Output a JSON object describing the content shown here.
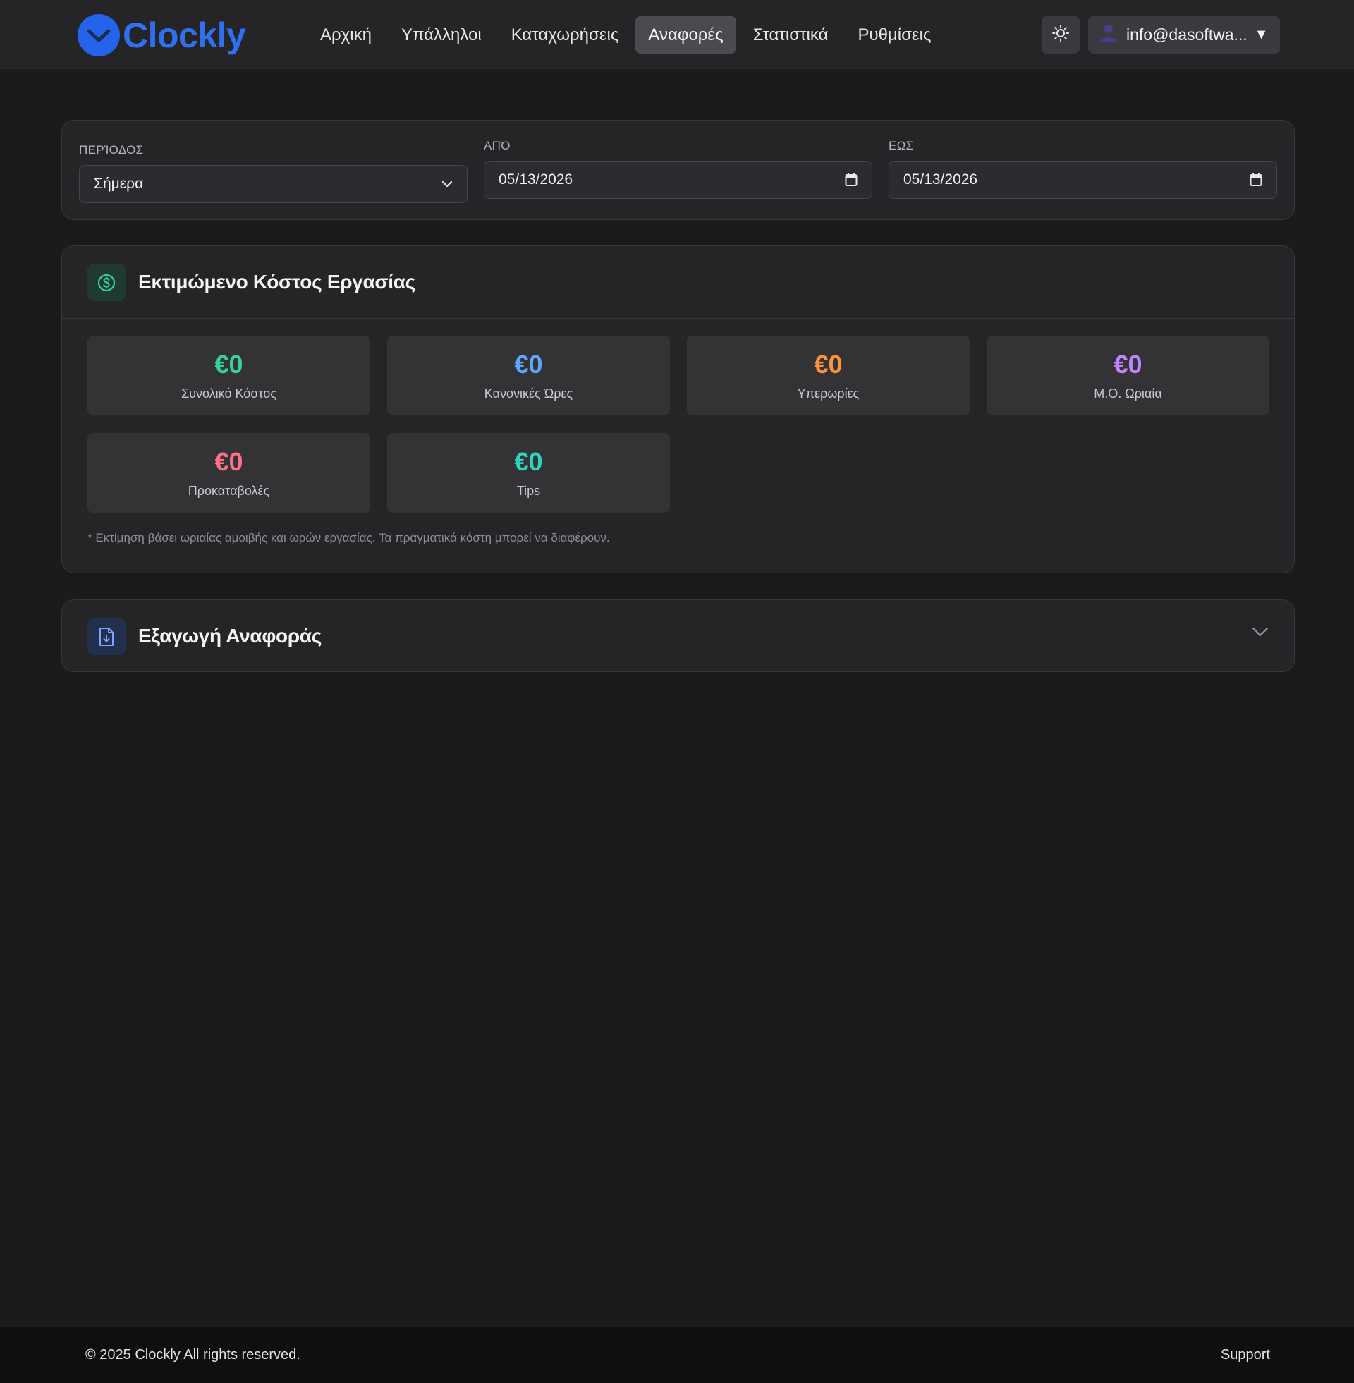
{
  "app": {
    "name": "Clockly",
    "brand_color": "#2563eb"
  },
  "nav": {
    "items": [
      {
        "label": "Αρχική",
        "active": false
      },
      {
        "label": "Υπάλληλοι",
        "active": false
      },
      {
        "label": "Καταχωρήσεις",
        "active": false
      },
      {
        "label": "Αναφορές",
        "active": true
      },
      {
        "label": "Στατιστικά",
        "active": false
      },
      {
        "label": "Ρυθμίσεις",
        "active": false
      }
    ]
  },
  "header": {
    "theme_icon": "sun-icon",
    "user_label": "info@dasoftwa...",
    "user_caret": "▼"
  },
  "filters": {
    "period_label": "ΠΕΡΊΟΔΟΣ",
    "period_value": "Σήμερα",
    "from_label": "ΑΠΌ",
    "from_value": "05/13/2026",
    "to_label": "ΕΩΣ",
    "to_value": "05/13/2026"
  },
  "cost": {
    "title": "Εκτιμώμενο Κόστος Εργασίας",
    "icon": "dollar-circle-icon",
    "cards": [
      {
        "value": "€0",
        "label": "Συνολικό Κόστος",
        "color": "#34d399"
      },
      {
        "value": "€0",
        "label": "Κανονικές Ώρες",
        "color": "#60a5fa"
      },
      {
        "value": "€0",
        "label": "Υπερωρίες",
        "color": "#fb923c"
      },
      {
        "value": "€0",
        "label": "Μ.Ο. Ωριαία",
        "color": "#c084fc"
      },
      {
        "value": "€0",
        "label": "Προκαταβολές",
        "color": "#fb7185"
      },
      {
        "value": "€0",
        "label": "Tips",
        "color": "#2dd4bf"
      }
    ],
    "note": "* Εκτίμηση βάσει ωριαίας αμοιβής και ωρών εργασίας. Τα πραγματικά κόστη μπορεί να διαφέρουν."
  },
  "export": {
    "title": "Εξαγωγή Αναφοράς",
    "icon": "file-download-icon"
  },
  "footer": {
    "copyright": "© 2025 Clockly All rights reserved.",
    "support": "Support"
  }
}
